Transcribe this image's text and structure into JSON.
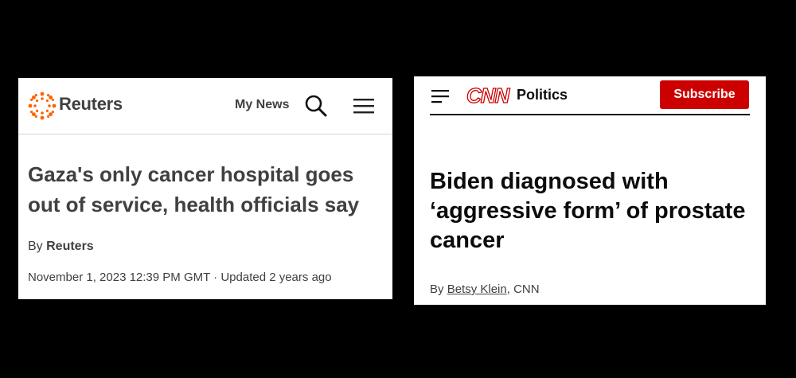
{
  "reuters": {
    "brand": "Reuters",
    "my_news_label": "My News",
    "headline": "Gaza's only cancer hospital goes out of service, health officials say",
    "byline_prefix": "By",
    "byline_author": "Reuters",
    "dateline": "November 1, 2023 12:39 PM GMT · Updated 2 years ago",
    "icons": {
      "logo": "reuters-logo",
      "search": "search-icon",
      "menu": "hamburger-menu-icon"
    },
    "colors": {
      "logo": "#fa6400",
      "text": "#404040"
    }
  },
  "cnn": {
    "logo_text": "CNN",
    "section": "Politics",
    "subscribe_label": "Subscribe",
    "headline": "Biden diagnosed with ‘aggressive form’ of prostate cancer",
    "byline_prefix": "By",
    "byline_author": "Betsy Klein",
    "byline_suffix": ", CNN",
    "icons": {
      "menu": "hamburger-menu-icon"
    },
    "colors": {
      "brand": "#cc0000",
      "text": "#0c0c0c"
    }
  }
}
